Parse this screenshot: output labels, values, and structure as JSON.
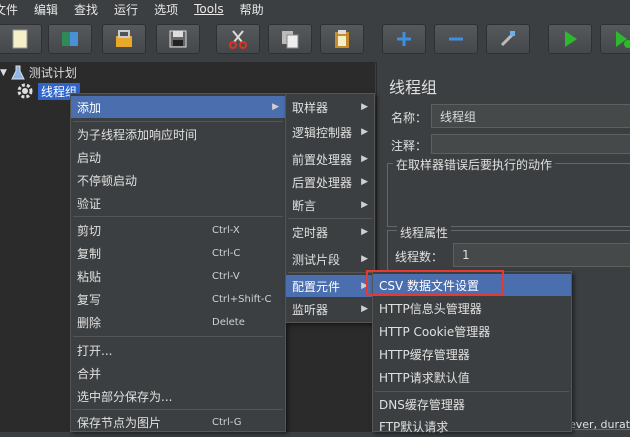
{
  "menubar": {
    "items": [
      "文件",
      "编辑",
      "查找",
      "运行",
      "选项",
      "Tools",
      "帮助"
    ]
  },
  "toolbar": {
    "buttons": [
      "new-icon",
      "templates-icon",
      "open-icon",
      "save-icon",
      "cut-icon",
      "copy-icon",
      "paste-icon",
      "expand-icon",
      "collapse-icon",
      "toggle-icon",
      "start-icon",
      "start-no-pause-icon"
    ]
  },
  "tree": {
    "root": "测试计划",
    "child": "线程组"
  },
  "context_menu": {
    "items": [
      {
        "label": "添加",
        "shortcut": ""
      },
      {
        "label": "为子线程添加响应时间",
        "shortcut": ""
      },
      {
        "label": "启动",
        "shortcut": ""
      },
      {
        "label": "不停顿启动",
        "shortcut": ""
      },
      {
        "label": "验证",
        "shortcut": ""
      },
      {
        "label": "剪切",
        "shortcut": "Ctrl-X"
      },
      {
        "label": "复制",
        "shortcut": "Ctrl-C"
      },
      {
        "label": "粘贴",
        "shortcut": "Ctrl-V"
      },
      {
        "label": "复写",
        "shortcut": "Ctrl+Shift-C"
      },
      {
        "label": "删除",
        "shortcut": "Delete"
      },
      {
        "label": "打开...",
        "shortcut": ""
      },
      {
        "label": "合并",
        "shortcut": ""
      },
      {
        "label": "选中部分保存为...",
        "shortcut": ""
      },
      {
        "label": "保存节点为图片",
        "shortcut": "Ctrl-G"
      }
    ]
  },
  "add_submenu": {
    "items": [
      "取样器",
      "逻辑控制器",
      "前置处理器",
      "后置处理器",
      "断言",
      "定时器",
      "测试片段",
      "配置元件",
      "监听器"
    ]
  },
  "config_submenu": {
    "items": [
      "CSV 数据文件设置",
      "HTTP信息头管理器",
      "HTTP Cookie管理器",
      "HTTP缓存管理器",
      "HTTP请求默认值",
      "DNS缓存管理器",
      "FTP默认请求"
    ]
  },
  "panel": {
    "title": "线程组",
    "name_label": "名称：",
    "name_value": "线程组",
    "comment_label": "注释：",
    "error_action_label": "在取样器错误后要执行的动作",
    "thread_props_label": "线程属性",
    "threads_label": "线程数：",
    "threads_value": "1",
    "bottom_text": "ever, durat"
  }
}
